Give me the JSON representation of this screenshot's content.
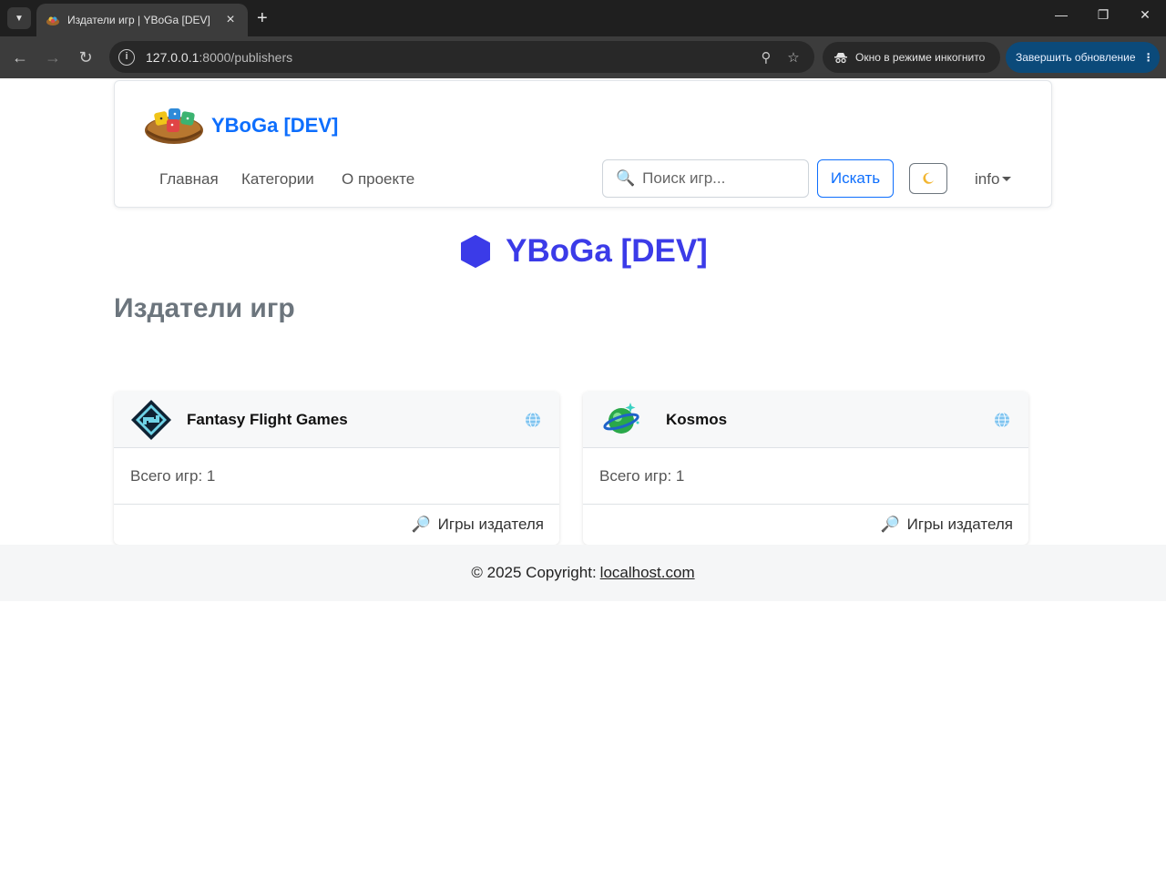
{
  "browser": {
    "tab_title": "Издатели игр | YBoGa [DEV]",
    "url_host": "127.0.0.1",
    "url_path": ":8000/publishers",
    "incognito_label": "Окно в режиме инкогнито",
    "update_label": "Завершить обновление",
    "icons": [
      "tab-search-icon",
      "close-icon",
      "plus-icon",
      "minimize-icon",
      "restore-icon",
      "window-close-icon",
      "back-icon",
      "forward-icon",
      "reload-icon",
      "info-icon",
      "zoom-icon",
      "star-icon",
      "incognito-icon",
      "menu-dots-icon"
    ]
  },
  "nav": {
    "brand": "YBoGa [DEV]",
    "links": [
      "Главная",
      "Категории",
      "О проекте"
    ],
    "search_placeholder": "Поиск игр...",
    "search_button": "Искать",
    "info_label": "info"
  },
  "hero": {
    "title": "YBoGa [DEV]",
    "color": "#3b3be8"
  },
  "page": {
    "title": "Издатели игр"
  },
  "publishers": [
    {
      "name": "Fantasy Flight Games",
      "count_text": "Всего игр: 1",
      "link_text": "Игры издателя"
    },
    {
      "name": "Kosmos",
      "count_text": "Всего игр: 1",
      "link_text": "Игры издателя"
    }
  ],
  "footer": {
    "text": "© 2025 Copyright:",
    "link": "localhost.com"
  },
  "colors": {
    "accent": "#0d6efd",
    "tab_bg": "#3c3c3c",
    "update_bg": "#0b4a7a"
  }
}
